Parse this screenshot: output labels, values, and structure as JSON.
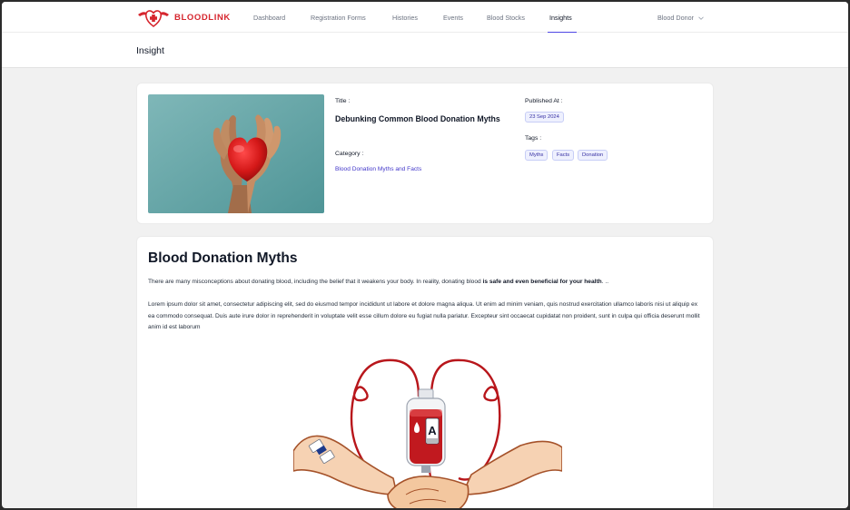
{
  "brand": {
    "name": "BLOODLINK",
    "accent": "#d6262e"
  },
  "nav": {
    "items": [
      "Dashboard",
      "Registration Forms",
      "Histories",
      "Events",
      "Blood Stocks",
      "Insights"
    ],
    "active": "Insights",
    "user_label": "Blood Donor"
  },
  "page": {
    "title": "Insight"
  },
  "insight": {
    "title_label": "Title :",
    "title": "Debunking Common Blood Donation Myths",
    "category_label": "Category :",
    "category": "Blood Donation Myths and Facts",
    "published_label": "Published At :",
    "published_date": "23 Sep 2024",
    "tags_label": "Tags :",
    "tags": [
      "Myths",
      "Facts",
      "Donation"
    ],
    "image_icon": "heart-in-hands-photo"
  },
  "article": {
    "heading": "Blood Donation Myths",
    "intro_pre": "There are many misconceptions about donating blood, including the belief that it weakens your body. In reality, donating blood ",
    "intro_bold": "is safe and even beneficial for your health",
    "intro_post": ". ..",
    "body": "Lorem ipsum dolor sit amet, consectetur adipiscing elit, sed do eiusmod tempor incididunt ut labore et dolore magna aliqua. Ut enim ad minim veniam, quis nostrud exercitation ullamco laboris nisi ut aliquip ex ea commodo consequat. Duis aute irure dolor in reprehenderit in voluptate velit esse cillum dolore eu fugiat nulla pariatur. Excepteur sint occaecat cupidatat non proident, sunt in culpa qui officia deserunt mollit anim id est laborum",
    "illustration": {
      "icon": "blood-transfusion-illustration",
      "bag_label": "A"
    }
  }
}
